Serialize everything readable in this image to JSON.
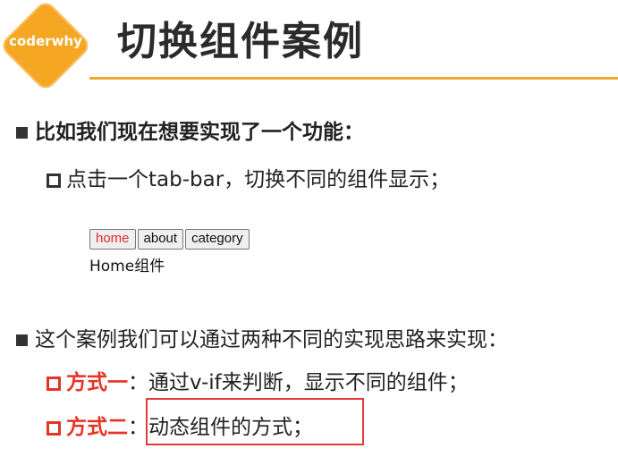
{
  "header": {
    "logo_text": "coderwhy",
    "title": "切换组件案例"
  },
  "points": {
    "p1": "比如我们现在想要实现了一个功能：",
    "p1_sub": "点击一个tab-bar，切换不同的组件显示；",
    "p2": "这个案例我们可以通过两种不同的实现思路来实现：",
    "m1_label": "方式一",
    "m1_sep": "：",
    "m1_text": "通过v-if来判断，显示不同的组件；",
    "m2_label": "方式二",
    "m2_sep": "：",
    "m2_text": "动态组件的方式；"
  },
  "demo": {
    "tabs": [
      {
        "label": "home",
        "active": true
      },
      {
        "label": "about",
        "active": false
      },
      {
        "label": "category",
        "active": false
      }
    ],
    "component_label": "Home组件"
  },
  "colors": {
    "accent_orange": "#f5a623",
    "rule_orange": "#f0a92e",
    "highlight_red": "#e63325",
    "active_tab_red": "#e22b2b"
  }
}
